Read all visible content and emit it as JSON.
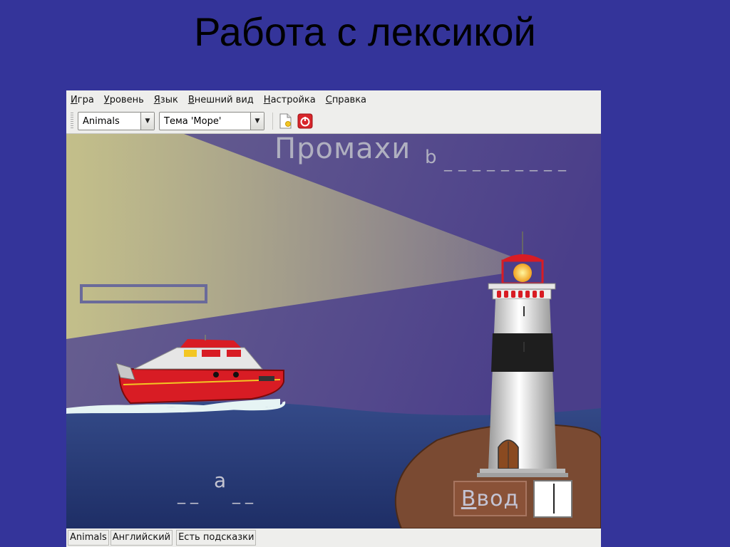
{
  "slide": {
    "title": "Работа с лексикой"
  },
  "menubar": {
    "items": [
      {
        "mnemonic": "И",
        "rest": "гра"
      },
      {
        "mnemonic": "У",
        "rest": "ровень"
      },
      {
        "mnemonic": "Я",
        "rest": "зык"
      },
      {
        "mnemonic": "В",
        "rest": "нешний вид"
      },
      {
        "mnemonic": "Н",
        "rest": "астройка"
      },
      {
        "mnemonic": "С",
        "rest": "правка"
      }
    ]
  },
  "toolbar": {
    "category_select": "Animals",
    "theme_select": "Тема 'Море'",
    "icons": [
      "new-game-icon",
      "quit-icon"
    ]
  },
  "game": {
    "misses_label": "Промахи",
    "missed_letter": "b",
    "miss_slots": "_ _ _ _ _ _ _ _ _",
    "word_prefix": "_ _",
    "word_letter": "a",
    "word_suffix": "_ _",
    "enter_mnemonic": "В",
    "enter_rest": "вод"
  },
  "colors": {
    "slide_background": "#34349a",
    "sky": "#5a4a92",
    "sea": "#2c3e7a",
    "island": "#7a4a32",
    "boat_hull": "#d81c24",
    "light_beam": "#c8c48a"
  },
  "statusbar": {
    "category": "Animals",
    "language": "Английский",
    "hints": "Есть подсказки"
  }
}
